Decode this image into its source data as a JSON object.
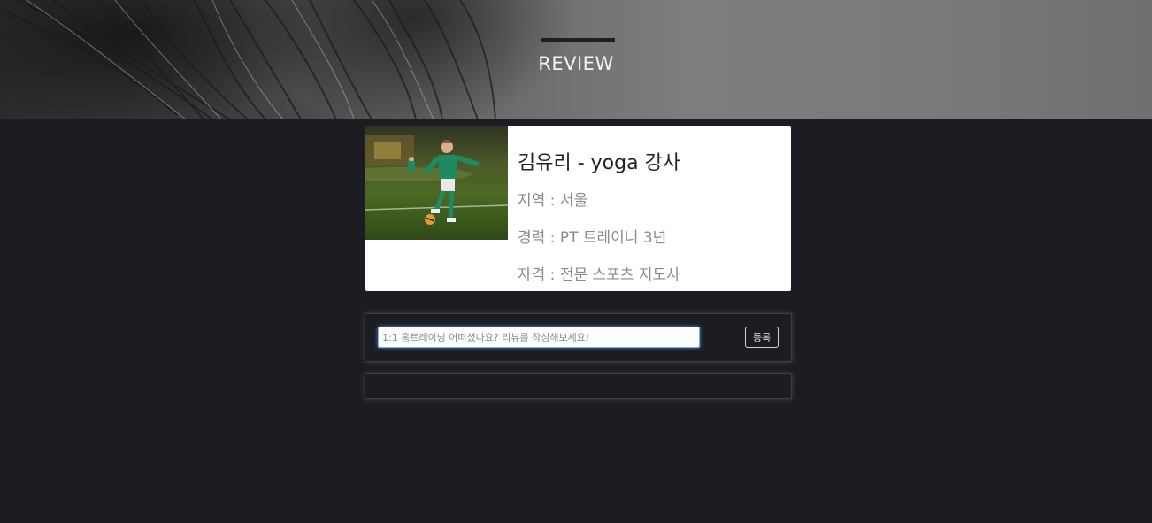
{
  "header": {
    "title": "REVIEW"
  },
  "trainer": {
    "name": "김유리 - yoga 강사",
    "region": "지역 : 서울",
    "career": "경력 : PT 트레이너 3년",
    "certification": "자격 : 전문 스포츠 지도사",
    "photo_icon": "soccer-kid-photo"
  },
  "review_form": {
    "placeholder": "1:1 홈트레이닝 어떠셨나요? 리뷰를 작성해보세요!",
    "value": "",
    "submit_label": "등록"
  },
  "review_list": {
    "items": []
  },
  "colors": {
    "page_background": "#1b1d22",
    "card_background": "#ffffff",
    "input_focus": "#7fb0ee"
  }
}
